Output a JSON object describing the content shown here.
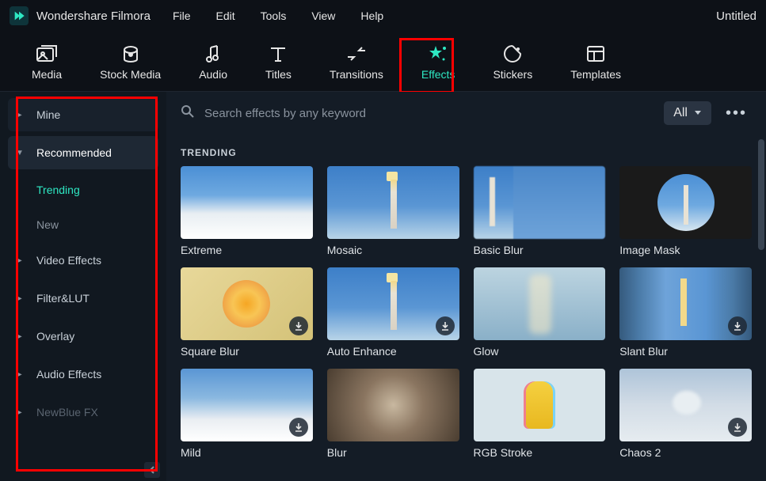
{
  "app": {
    "title": "Wondershare Filmora",
    "doc": "Untitled"
  },
  "menu": [
    "File",
    "Edit",
    "Tools",
    "View",
    "Help"
  ],
  "tools": [
    {
      "id": "media",
      "label": "Media"
    },
    {
      "id": "stock",
      "label": "Stock Media"
    },
    {
      "id": "audio",
      "label": "Audio"
    },
    {
      "id": "titles",
      "label": "Titles"
    },
    {
      "id": "transitions",
      "label": "Transitions"
    },
    {
      "id": "effects",
      "label": "Effects",
      "active": true
    },
    {
      "id": "stickers",
      "label": "Stickers"
    },
    {
      "id": "templates",
      "label": "Templates"
    }
  ],
  "sidebar": {
    "items": [
      {
        "label": "Mine",
        "expandable": true
      },
      {
        "label": "Recommended",
        "expandable": true,
        "expanded": true
      },
      {
        "label": "Trending",
        "sub": true,
        "active": true
      },
      {
        "label": "New",
        "sub": true
      },
      {
        "label": "Video Effects",
        "expandable": true
      },
      {
        "label": "Filter&LUT",
        "expandable": true
      },
      {
        "label": "Overlay",
        "expandable": true
      },
      {
        "label": "Audio Effects",
        "expandable": true
      },
      {
        "label": "NewBlue FX",
        "expandable": true,
        "dim": true
      }
    ]
  },
  "search": {
    "placeholder": "Search effects by any keyword"
  },
  "filter": {
    "label": "All"
  },
  "section": "TRENDING",
  "effects": [
    {
      "label": "Extreme",
      "thumb": "th-sky"
    },
    {
      "label": "Mosaic",
      "thumb": "th-lighthouse"
    },
    {
      "label": "Basic Blur",
      "thumb": "th-blur-light"
    },
    {
      "label": "Image Mask",
      "thumb": "th-mask"
    },
    {
      "label": "Square Blur",
      "thumb": "th-flower",
      "download": true
    },
    {
      "label": "Auto Enhance",
      "thumb": "th-lighthouse",
      "download": true
    },
    {
      "label": "Glow",
      "thumb": "th-glow"
    },
    {
      "label": "Slant Blur",
      "thumb": "th-slant",
      "download": true
    },
    {
      "label": "Mild",
      "thumb": "th-mild",
      "download": true
    },
    {
      "label": "Blur",
      "thumb": "th-zoom"
    },
    {
      "label": "RGB Stroke",
      "thumb": "th-rgb"
    },
    {
      "label": "Chaos 2",
      "thumb": "th-chaos",
      "download": true
    }
  ]
}
